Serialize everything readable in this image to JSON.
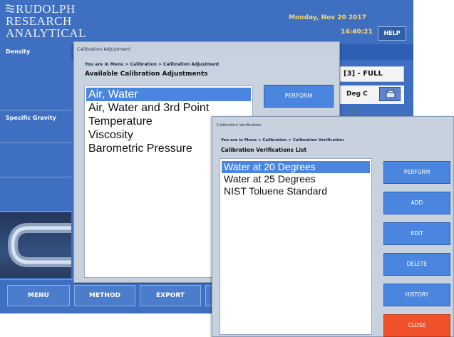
{
  "header": {
    "logo_lines": [
      "RUDOLPH",
      "RESEARCH",
      "ANALYTICAL"
    ],
    "date": "Monday, Nov 20 2017",
    "time": "14:40:21",
    "help_label": "HELP"
  },
  "sidebar": {
    "items": [
      {
        "label": "Density"
      },
      {
        "label": "Specific Gravity"
      }
    ]
  },
  "readout": {
    "mode_label": "[3] - FULL",
    "unit": "Deg C",
    "unit_secondary": "Deg C"
  },
  "bottom_menu": {
    "menu_label": "MENU",
    "method_label": "METHOD",
    "export_label": "EXPORT"
  },
  "calibration_adjustment": {
    "title": "Calibration Adjustment",
    "breadcrumb": "You are in  Menu > Calibration > Calibration Adjustment",
    "heading": "Available Calibration Adjustments",
    "items": [
      "Air, Water",
      "Air, Water and 3rd Point",
      "Temperature",
      "Viscosity",
      "Barometric Pressure"
    ],
    "selected_index": 0,
    "perform_label": "PERFORM"
  },
  "calibration_verification": {
    "title": "Calibration Verification",
    "breadcrumb": "You are in  Menu > Calibration > Calibration Verification",
    "heading": "Calibration Verifications List",
    "items": [
      "Water at 20 Degrees",
      "Water at 25 Degrees",
      "NIST Toluene Standard"
    ],
    "selected_index": 0,
    "buttons": {
      "perform": "PERFORM",
      "add": "ADD",
      "edit": "EDIT",
      "delete": "DELETE",
      "history": "HISTORY",
      "close": "CLOSE"
    }
  },
  "colors": {
    "app_blue": "#3f6fc0",
    "selection_blue": "#4a86e0",
    "dialog_grey": "#c8d2df",
    "close_red": "#f0512a",
    "clock_yellow": "#f7d774"
  }
}
